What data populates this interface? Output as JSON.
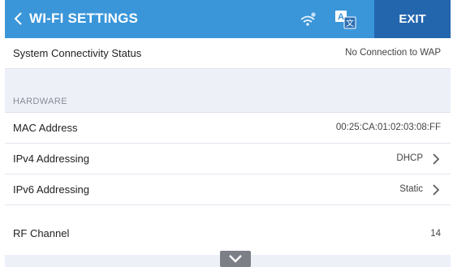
{
  "header": {
    "title": "WI-FI SETTINGS",
    "exit_label": "EXIT",
    "back_icon": "chevron-left-icon",
    "wifi_icon": "wifi-status-icon",
    "language_icon": "translate-icon",
    "colors": {
      "header_bg": "#3a96d9",
      "exit_bg": "#2366ae"
    }
  },
  "status": {
    "label": "System Connectivity Status",
    "value": "No Connection to WAP"
  },
  "hardware": {
    "section_label": "HARDWARE",
    "rows": [
      {
        "label": "MAC Address",
        "value": "00:25:CA:01:02:03:08:FF"
      },
      {
        "label": "IPv4 Addressing",
        "value": "DHCP"
      },
      {
        "label": "IPv6 Addressing",
        "value": "Static"
      },
      {
        "label": "RF Channel",
        "value": "14"
      }
    ]
  },
  "scroll": {
    "icon": "chevron-down-icon"
  }
}
